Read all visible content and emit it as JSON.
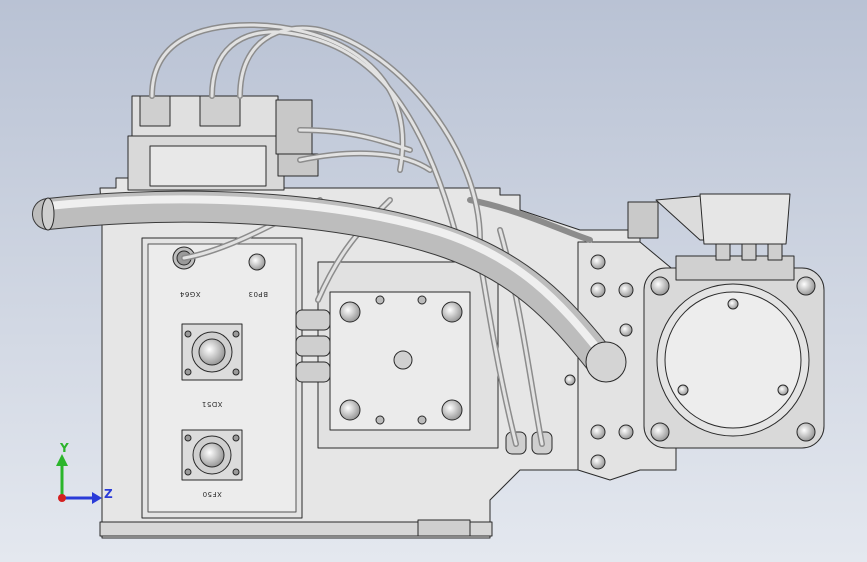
{
  "viewport": {
    "background_top": "#b9c2d4",
    "background_bottom": "#e4e8ef"
  },
  "labels": {
    "xg64": "XG64",
    "bp03": "BP03",
    "xd51": "XD51",
    "xf50": "XF50"
  },
  "triad": {
    "y_label": "Y",
    "z_label": "Z",
    "y_color": "#2bb52b",
    "z_color": "#2a3bd8",
    "origin_color": "#d42020"
  },
  "colors": {
    "part_fill": "#e6e6e6",
    "part_shade": "#cfcfcf",
    "edge": "#2a2a2a",
    "tube": "#bdbdbd"
  }
}
